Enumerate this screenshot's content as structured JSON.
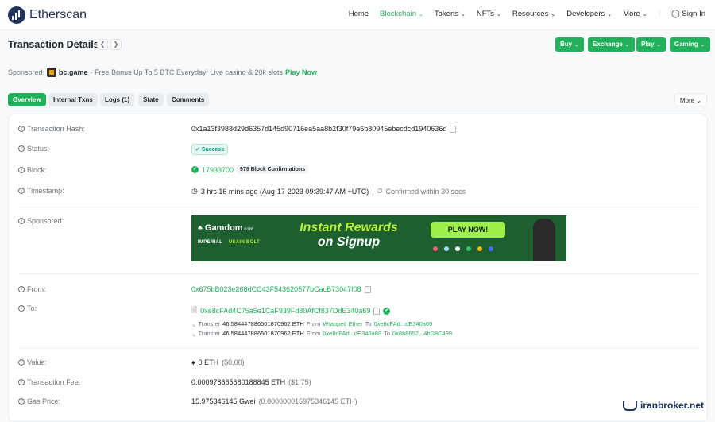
{
  "header": {
    "logo_text": "Etherscan",
    "nav": [
      {
        "label": "Home",
        "dropdown": false
      },
      {
        "label": "Blockchain",
        "dropdown": true,
        "active": true
      },
      {
        "label": "Tokens",
        "dropdown": true
      },
      {
        "label": "NFTs",
        "dropdown": true
      },
      {
        "label": "Resources",
        "dropdown": true
      },
      {
        "label": "Developers",
        "dropdown": true
      },
      {
        "label": "More",
        "dropdown": true
      }
    ],
    "signin_label": "Sign In"
  },
  "page": {
    "title": "Transaction Details",
    "prev_icon": "chevron-left-icon",
    "next_icon": "chevron-right-icon",
    "action_buttons": [
      "Buy",
      "Exchange",
      "Play",
      "Gaming"
    ]
  },
  "sponsored": {
    "label": "Sponsored:",
    "brand": "bc.game",
    "text": " - Free Bonus Up To 5 BTC Everyday! Live casino & 20k slots ",
    "cta": "Play Now"
  },
  "tabs": [
    {
      "label": "Overview",
      "active": true
    },
    {
      "label": "Internal Txns",
      "active": false
    },
    {
      "label": "Logs (1)",
      "active": false
    },
    {
      "label": "State",
      "active": false
    },
    {
      "label": "Comments",
      "active": false
    }
  ],
  "more_label": "More",
  "details": {
    "tx_hash": {
      "label": "Transaction Hash:",
      "value": "0x1a13f3988d29d6357d145d90716ea5aa8b2f30f79e6b80945ebecdcd1940636d"
    },
    "status": {
      "label": "Status:",
      "value": "Success"
    },
    "block": {
      "label": "Block:",
      "value": "17933700",
      "confirmations": "979 Block Confirmations"
    },
    "timestamp": {
      "label": "Timestamp:",
      "value": "3 hrs 16 mins ago (Aug-17-2023 09:39:47 AM +UTC)",
      "separator": "|",
      "confirmed": "Confirmed within 30 secs"
    },
    "sponsored": {
      "label": "Sponsored:"
    },
    "from": {
      "label": "From:",
      "value": "0x675bB023e268dCC43F543620577bCacB73047f08"
    },
    "to": {
      "label": "To:",
      "value": "0xe8cFAd4C75a5e1CaF939Fd80AfCf837DdE340a69",
      "transfers": [
        {
          "prefix": "Transfer",
          "amount": "46.584447886501870962 ETH",
          "from_word": "From",
          "from": "Wrapped Ether",
          "to_word": "To",
          "to": "0xe8cFAd...dE340a69"
        },
        {
          "prefix": "Transfer",
          "amount": "46.584447886501870962 ETH",
          "from_word": "From",
          "from": "0xe8cFAd...dE340a69",
          "to_word": "To",
          "to": "0x8b8652...4bD8C499"
        }
      ]
    },
    "value": {
      "label": "Value:",
      "value": "0 ETH",
      "usd": "($0.00)"
    },
    "fee": {
      "label": "Transaction Fee:",
      "value": "0.000978665680188845 ETH",
      "usd": "($1.75)"
    },
    "gas": {
      "label": "Gas Price:",
      "value": "15.975346145 Gwei",
      "eth": "(0.000000015975346145 ETH)"
    }
  },
  "ad_banner": {
    "brand": "Gamdom",
    "brand_suffix": ".com",
    "partner1": "IMPERIAL",
    "partner2": "USAIN BOLT",
    "headline1": "Instant Rewards",
    "headline2": "on Signup",
    "button": "PLAY NOW!"
  },
  "watermark": {
    "text": "iranbroker.net"
  },
  "colors": {
    "brand_green": "#20b15a",
    "link_blue": "#0784c3",
    "navy": "#21325b"
  }
}
